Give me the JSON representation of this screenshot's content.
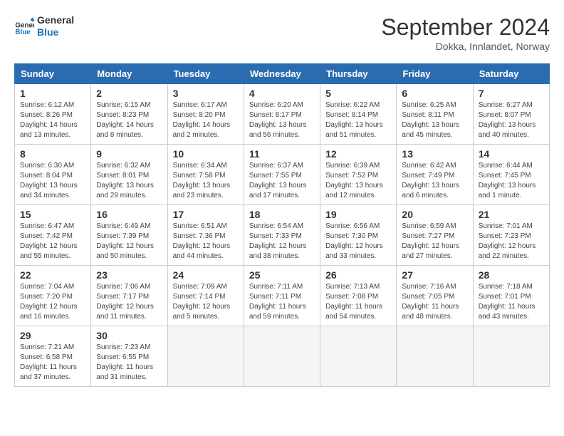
{
  "header": {
    "logo_line1": "General",
    "logo_line2": "Blue",
    "month_title": "September 2024",
    "location": "Dokka, Innlandet, Norway"
  },
  "days_of_week": [
    "Sunday",
    "Monday",
    "Tuesday",
    "Wednesday",
    "Thursday",
    "Friday",
    "Saturday"
  ],
  "weeks": [
    [
      {
        "day": "1",
        "sunrise": "6:12 AM",
        "sunset": "8:26 PM",
        "daylight": "14 hours and 13 minutes."
      },
      {
        "day": "2",
        "sunrise": "6:15 AM",
        "sunset": "8:23 PM",
        "daylight": "14 hours and 8 minutes."
      },
      {
        "day": "3",
        "sunrise": "6:17 AM",
        "sunset": "8:20 PM",
        "daylight": "14 hours and 2 minutes."
      },
      {
        "day": "4",
        "sunrise": "6:20 AM",
        "sunset": "8:17 PM",
        "daylight": "13 hours and 56 minutes."
      },
      {
        "day": "5",
        "sunrise": "6:22 AM",
        "sunset": "8:14 PM",
        "daylight": "13 hours and 51 minutes."
      },
      {
        "day": "6",
        "sunrise": "6:25 AM",
        "sunset": "8:11 PM",
        "daylight": "13 hours and 45 minutes."
      },
      {
        "day": "7",
        "sunrise": "6:27 AM",
        "sunset": "8:07 PM",
        "daylight": "13 hours and 40 minutes."
      }
    ],
    [
      {
        "day": "8",
        "sunrise": "6:30 AM",
        "sunset": "8:04 PM",
        "daylight": "13 hours and 34 minutes."
      },
      {
        "day": "9",
        "sunrise": "6:32 AM",
        "sunset": "8:01 PM",
        "daylight": "13 hours and 29 minutes."
      },
      {
        "day": "10",
        "sunrise": "6:34 AM",
        "sunset": "7:58 PM",
        "daylight": "13 hours and 23 minutes."
      },
      {
        "day": "11",
        "sunrise": "6:37 AM",
        "sunset": "7:55 PM",
        "daylight": "13 hours and 17 minutes."
      },
      {
        "day": "12",
        "sunrise": "6:39 AM",
        "sunset": "7:52 PM",
        "daylight": "13 hours and 12 minutes."
      },
      {
        "day": "13",
        "sunrise": "6:42 AM",
        "sunset": "7:49 PM",
        "daylight": "13 hours and 6 minutes."
      },
      {
        "day": "14",
        "sunrise": "6:44 AM",
        "sunset": "7:45 PM",
        "daylight": "13 hours and 1 minute."
      }
    ],
    [
      {
        "day": "15",
        "sunrise": "6:47 AM",
        "sunset": "7:42 PM",
        "daylight": "12 hours and 55 minutes."
      },
      {
        "day": "16",
        "sunrise": "6:49 AM",
        "sunset": "7:39 PM",
        "daylight": "12 hours and 50 minutes."
      },
      {
        "day": "17",
        "sunrise": "6:51 AM",
        "sunset": "7:36 PM",
        "daylight": "12 hours and 44 minutes."
      },
      {
        "day": "18",
        "sunrise": "6:54 AM",
        "sunset": "7:33 PM",
        "daylight": "12 hours and 38 minutes."
      },
      {
        "day": "19",
        "sunrise": "6:56 AM",
        "sunset": "7:30 PM",
        "daylight": "12 hours and 33 minutes."
      },
      {
        "day": "20",
        "sunrise": "6:59 AM",
        "sunset": "7:27 PM",
        "daylight": "12 hours and 27 minutes."
      },
      {
        "day": "21",
        "sunrise": "7:01 AM",
        "sunset": "7:23 PM",
        "daylight": "12 hours and 22 minutes."
      }
    ],
    [
      {
        "day": "22",
        "sunrise": "7:04 AM",
        "sunset": "7:20 PM",
        "daylight": "12 hours and 16 minutes."
      },
      {
        "day": "23",
        "sunrise": "7:06 AM",
        "sunset": "7:17 PM",
        "daylight": "12 hours and 11 minutes."
      },
      {
        "day": "24",
        "sunrise": "7:09 AM",
        "sunset": "7:14 PM",
        "daylight": "12 hours and 5 minutes."
      },
      {
        "day": "25",
        "sunrise": "7:11 AM",
        "sunset": "7:11 PM",
        "daylight": "11 hours and 59 minutes."
      },
      {
        "day": "26",
        "sunrise": "7:13 AM",
        "sunset": "7:08 PM",
        "daylight": "11 hours and 54 minutes."
      },
      {
        "day": "27",
        "sunrise": "7:16 AM",
        "sunset": "7:05 PM",
        "daylight": "11 hours and 48 minutes."
      },
      {
        "day": "28",
        "sunrise": "7:18 AM",
        "sunset": "7:01 PM",
        "daylight": "11 hours and 43 minutes."
      }
    ],
    [
      {
        "day": "29",
        "sunrise": "7:21 AM",
        "sunset": "6:58 PM",
        "daylight": "11 hours and 37 minutes."
      },
      {
        "day": "30",
        "sunrise": "7:23 AM",
        "sunset": "6:55 PM",
        "daylight": "11 hours and 31 minutes."
      },
      null,
      null,
      null,
      null,
      null
    ]
  ],
  "labels": {
    "sunrise": "Sunrise: ",
    "sunset": "Sunset: ",
    "daylight": "Daylight: "
  }
}
